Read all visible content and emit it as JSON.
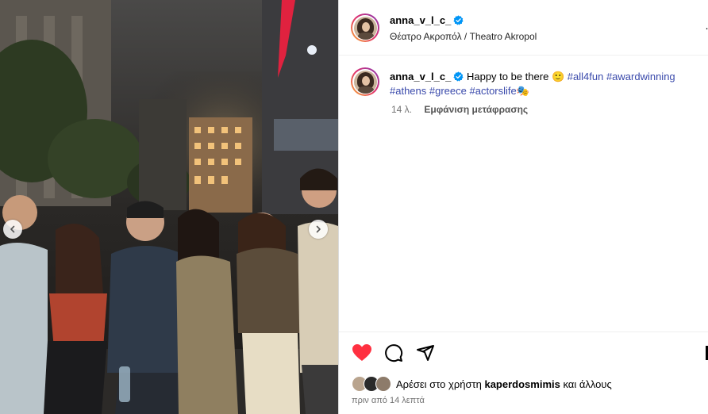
{
  "post": {
    "username": "anna_v_l_c_",
    "location": "Θέατρο Ακροπόλ / Theatro Akropol",
    "more_label": "…",
    "caption_text": "Happy to be there",
    "caption_emoji": "🙂",
    "hashtags_line1": [
      "#all4fun",
      "#awardwinning"
    ],
    "hashtags_line2": [
      "#athens",
      "#greece",
      "#actorslife🎭"
    ],
    "age": "14 λ.",
    "translate_label": "Εμφάνιση μετάφρασης",
    "likes_prefix": "Αρέσει στο χρήστη",
    "likes_user": "kaperdosmimis",
    "likes_suffix": "και άλλους",
    "time_ago": "πριν από 14 λεπτά",
    "liked": true
  },
  "icons": [
    "verified-badge-icon",
    "heart-icon",
    "comment-icon",
    "share-icon",
    "chevron-left-icon",
    "chevron-right-icon"
  ],
  "colors": {
    "like_red": "#ff3040",
    "verified_blue": "#0095f6",
    "hashtag": "#3949ab",
    "secondary_text": "#737373"
  }
}
